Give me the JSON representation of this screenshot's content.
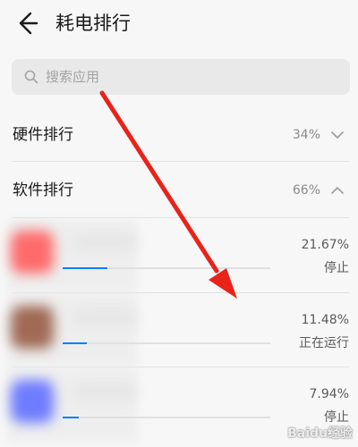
{
  "appbar": {
    "title": "耗电排行",
    "back_icon": "back-arrow-icon"
  },
  "search": {
    "placeholder": "搜索应用",
    "icon": "search-icon"
  },
  "sections": [
    {
      "label": "硬件排行",
      "percent": "34%",
      "chevron": "chevron-down-icon"
    },
    {
      "label": "软件排行",
      "percent": "66%",
      "chevron": "chevron-up-icon"
    }
  ],
  "apps": [
    {
      "percent": "21.67%",
      "status": "停止",
      "usage_fraction": 0.2167,
      "icon_color": "#ff6b6b"
    },
    {
      "percent": "11.48%",
      "status": "正在运行",
      "usage_fraction": 0.1148,
      "icon_color": "#a06a55"
    },
    {
      "percent": "7.94%",
      "status": "停止",
      "usage_fraction": 0.0794,
      "icon_color": "#6e7cff"
    }
  ],
  "overlay": {
    "arrow_color": "#e8231a"
  },
  "watermark": {
    "text": "Baidu经验"
  },
  "colors": {
    "accent": "#007dff",
    "background": "#f7f7f7"
  }
}
